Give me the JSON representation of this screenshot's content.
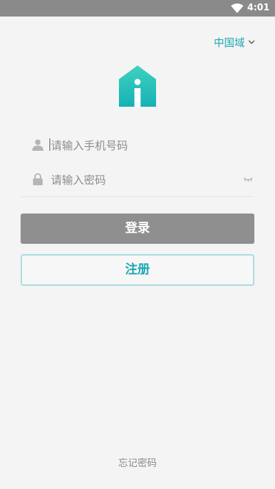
{
  "status_bar": {
    "time": "4:01",
    "wifi_icon": "wifi-icon"
  },
  "region_selector": {
    "label": "中国域",
    "chevron_icon": "chevron-down-icon"
  },
  "logo": {
    "icon": "house-logo-icon",
    "color": "#2ec4b6"
  },
  "phone_field": {
    "placeholder": "请输入手机号码",
    "value": "",
    "icon": "user-icon"
  },
  "password_field": {
    "placeholder": "请输入密码",
    "value": "",
    "icon": "lock-icon",
    "toggle_icon": "eye-closed-icon"
  },
  "buttons": {
    "login_label": "登录",
    "register_label": "注册"
  },
  "forgot_password": "忘记密码",
  "colors": {
    "accent": "#1aa7b1",
    "login_bg": "#8f8f8f",
    "register_border": "#a7dbe0",
    "background": "#f4f4f4"
  }
}
